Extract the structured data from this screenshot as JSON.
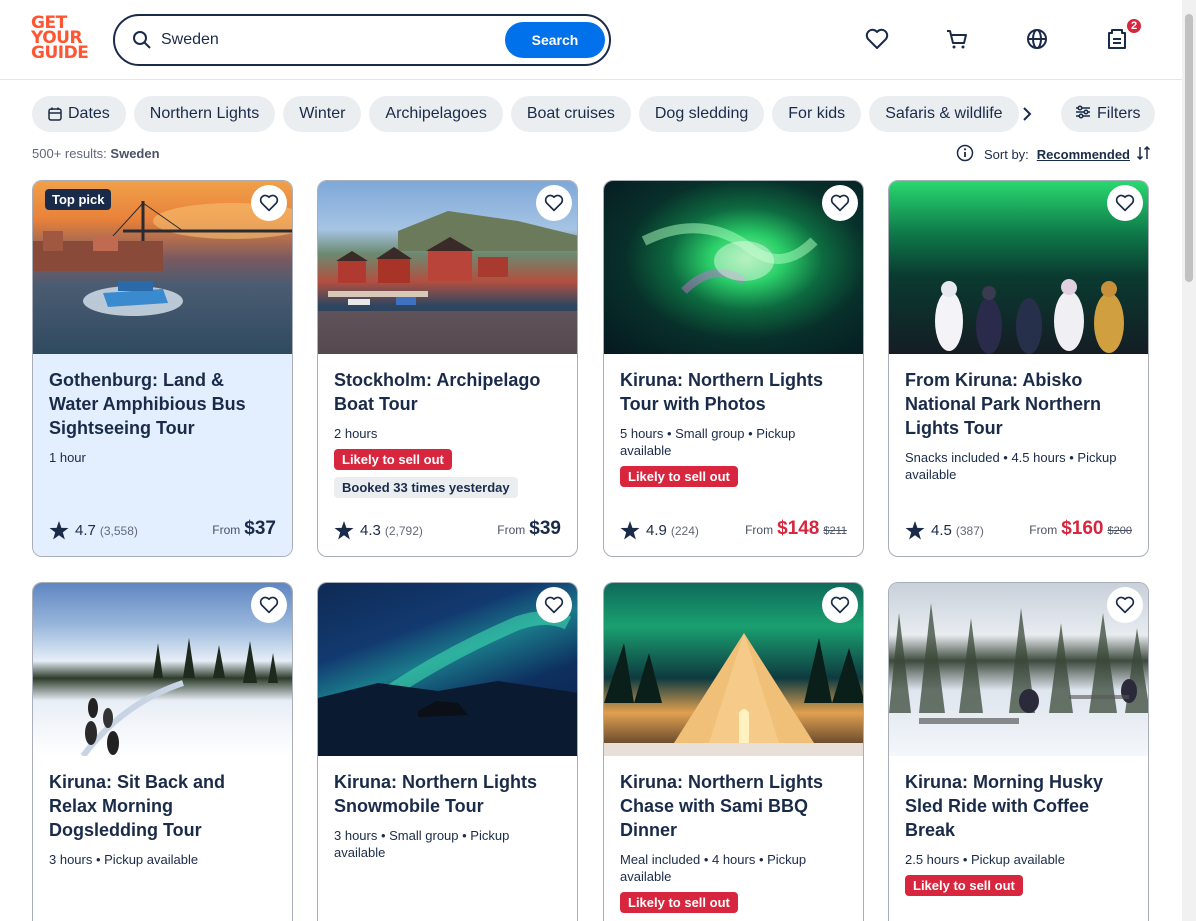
{
  "header": {
    "logo_lines": [
      "GET",
      "YOUR",
      "GUIDE"
    ],
    "search_value": "Sweden",
    "search_button": "Search",
    "cart_badge": "2"
  },
  "chips": {
    "dates": "Dates",
    "items": [
      "Northern Lights",
      "Winter",
      "Archipelagoes",
      "Boat cruises",
      "Dog sledding",
      "For kids",
      "Safaris & wildlife"
    ],
    "filters": "Filters"
  },
  "results": {
    "count": "500+ results:",
    "query": "Sweden",
    "sort_label": "Sort by:",
    "sort_value": "Recommended"
  },
  "cards": [
    {
      "badge": "Top pick",
      "title": "Gothenburg: Land & Water Amphibious Bus Sightseeing Tour",
      "meta": "1 hour",
      "rating": "4.7",
      "count": "(3,558)",
      "from": "From",
      "price": "$37"
    },
    {
      "title": "Stockholm: Archipelago Boat Tour",
      "meta": "2 hours",
      "pill_red": "Likely to sell out",
      "pill_gray": "Booked 33 times yesterday",
      "rating": "4.3",
      "count": "(2,792)",
      "from": "From",
      "price": "$39"
    },
    {
      "title": "Kiruna: Northern Lights Tour with Photos",
      "meta": "5 hours • Small group • Pickup available",
      "pill_red": "Likely to sell out",
      "rating": "4.9",
      "count": "(224)",
      "from": "From",
      "price": "$148",
      "old_price": "$211"
    },
    {
      "title": "From Kiruna: Abisko National Park Northern Lights Tour",
      "meta": "Snacks included • 4.5 hours • Pickup available",
      "rating": "4.5",
      "count": "(387)",
      "from": "From",
      "price": "$160",
      "old_price": "$200"
    },
    {
      "title": "Kiruna: Sit Back and Relax Morning Dogsledding Tour",
      "meta": "3 hours • Pickup available"
    },
    {
      "title": "Kiruna: Northern Lights Snowmobile Tour",
      "meta": "3 hours • Small group • Pickup available"
    },
    {
      "title": "Kiruna: Northern Lights Chase with Sami BBQ Dinner",
      "meta": "Meal included • 4 hours • Pickup available",
      "pill_red": "Likely to sell out"
    },
    {
      "title": "Kiruna: Morning Husky Sled Ride with Coffee Break",
      "meta": "2.5 hours • Pickup available",
      "pill_red": "Likely to sell out"
    }
  ]
}
